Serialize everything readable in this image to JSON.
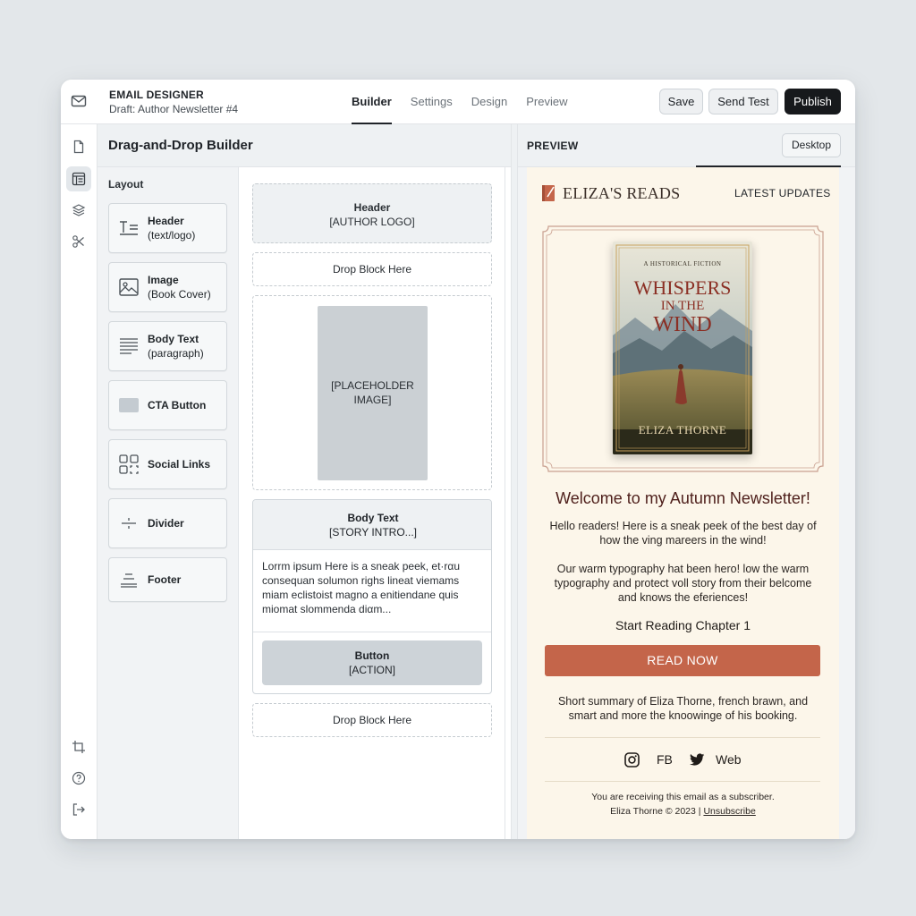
{
  "app": {
    "title": "EMAIL DESIGNER",
    "subtitle": "Draft: Author Newsletter #4"
  },
  "tabs": [
    {
      "label": "Builder",
      "active": true
    },
    {
      "label": "Settings",
      "active": false
    },
    {
      "label": "Design",
      "active": false
    },
    {
      "label": "Preview",
      "active": false
    }
  ],
  "actions": {
    "save": "Save",
    "send_test": "Send Test",
    "publish": "Publish"
  },
  "rail": {
    "top_icons": [
      "document-icon",
      "layout-icon",
      "layers-icon",
      "tools-icon"
    ],
    "bottom_icons": [
      "crop-icon",
      "help-icon",
      "logout-icon"
    ],
    "active": "layout-icon"
  },
  "builder": {
    "title": "Drag-and-Drop Builder",
    "palette_label": "Layout",
    "palette": [
      {
        "line1": "Header",
        "line2": "(text/logo)",
        "icon": "header-icon"
      },
      {
        "line1": "Image",
        "line2": "(Book Cover)",
        "icon": "image-icon"
      },
      {
        "line1": "Body Text",
        "line2": "(paragraph)",
        "icon": "paragraph-icon"
      },
      {
        "line1": "CTA Button",
        "line2": "",
        "icon": "button-icon"
      },
      {
        "line1": "Social Links",
        "line2": "",
        "icon": "grid-icon"
      },
      {
        "line1": "Divider",
        "line2": "",
        "icon": "divider-icon"
      },
      {
        "line1": "Footer",
        "line2": "",
        "icon": "footer-icon"
      }
    ],
    "canvas": {
      "header_block": {
        "title": "Header",
        "sub": "[AUTHOR LOGO]"
      },
      "drop_1": "Drop Block Here",
      "image_block": {
        "line1": "[PLACEHOLDER",
        "line2": "IMAGE]"
      },
      "body_block": {
        "title": "Body Text",
        "sub": "[STORY INTRO...]",
        "content": "Lorrm ipsum Here is a sneak peek, et·rαu consequan solumon righs lineat viemams miam eclistoist magno a enitiendane quis miomat slommenda diαm..."
      },
      "button_block": {
        "title": "Button",
        "sub": "[ACTION]"
      },
      "drop_2": "Drop Block Here"
    }
  },
  "preview": {
    "title": "PREVIEW",
    "device": "Desktop",
    "email": {
      "brand": "ELIZA'S READS",
      "updates": "LATEST UPDATES",
      "book": {
        "kicker": "A HISTORICAL FICTION",
        "title_1": "WHISPERS",
        "title_2": "IN THE",
        "title_3": "WIND",
        "author": "ELIZA THORNE"
      },
      "welcome": "Welcome to my Autumn Newsletter!",
      "para_1": "Hello readers! Here is a sneak peek of the best day of how the ving mareers in the wind!",
      "para_2": "Our warm typography hat been hero! low the warm typography and protect voll story from their belcome and knows the eferiences!",
      "chapter": "Start Reading Chapter 1",
      "cta": "READ NOW",
      "summary": "Short summary of Eliza Thorne, french brawn, and smart and more the knoowinge of his booking.",
      "social": [
        {
          "label": "",
          "icon": "instagram-icon"
        },
        {
          "label": "FB",
          "icon": ""
        },
        {
          "label": "",
          "icon": "twitter-icon"
        },
        {
          "label": "Web",
          "icon": ""
        }
      ],
      "footer_1": "You are receiving this email as a subscriber.",
      "footer_2": "Eliza Thorne © 2023 |",
      "unsubscribe": "Unsubscribe"
    }
  },
  "colors": {
    "accent_cta": "#c4654a",
    "email_bg": "#fcf6ea",
    "dark_button": "#17191c",
    "headline": "#4e1f1b"
  }
}
